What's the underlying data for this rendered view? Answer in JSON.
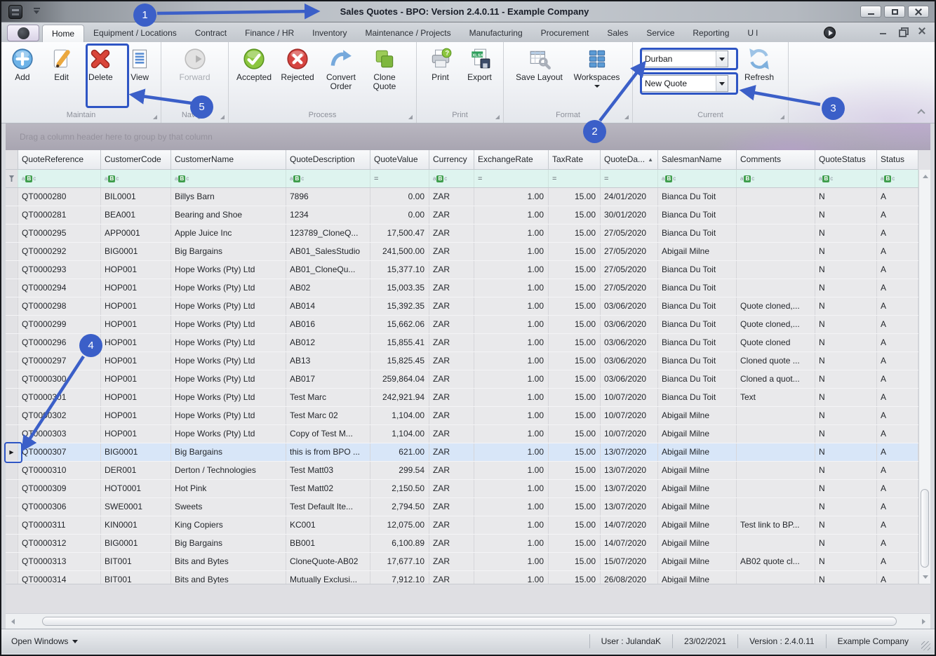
{
  "window": {
    "title": "Sales Quotes - BPO: Version 2.4.0.11 - Example Company"
  },
  "tabs": [
    {
      "label": "Home",
      "selected": true
    },
    {
      "label": "Equipment / Locations"
    },
    {
      "label": "Contract"
    },
    {
      "label": "Finance / HR"
    },
    {
      "label": "Inventory"
    },
    {
      "label": "Maintenance / Projects"
    },
    {
      "label": "Manufacturing"
    },
    {
      "label": "Procurement"
    },
    {
      "label": "Sales"
    },
    {
      "label": "Service"
    },
    {
      "label": "Reporting"
    },
    {
      "label": "U l",
      "obscured": true
    }
  ],
  "ribbon": {
    "groups": [
      {
        "caption": "Maintain",
        "buttons": [
          {
            "label": "Add"
          },
          {
            "label": "Edit"
          },
          {
            "label": "Delete",
            "highlighted": true
          },
          {
            "label": "View"
          }
        ]
      },
      {
        "caption": "Navig...",
        "buttons": [
          {
            "label": "Forward",
            "disabled": true
          }
        ]
      },
      {
        "caption": "Process",
        "buttons": [
          {
            "label": "Accepted"
          },
          {
            "label": "Rejected"
          },
          {
            "label": "Convert\nOrder"
          },
          {
            "label": "Clone\nQuote"
          }
        ]
      },
      {
        "caption": "Print",
        "buttons": [
          {
            "label": "Print"
          },
          {
            "label": "Export"
          }
        ]
      },
      {
        "caption": "Format",
        "buttons": [
          {
            "label": "Save Layout"
          },
          {
            "label": "Workspaces",
            "dropdown": true
          }
        ]
      },
      {
        "caption": "Current",
        "combos": [
          {
            "value": "Durban",
            "highlighted": true
          },
          {
            "value": "New Quote",
            "highlighted": true
          }
        ],
        "buttons": [
          {
            "label": "Refresh"
          }
        ]
      }
    ]
  },
  "icons": {
    "dialog_launcher": "◢",
    "sort_asc": "▲",
    "row_marker": "▶",
    "export_badge": "XLSX",
    "print_badge": "?"
  },
  "grid": {
    "groupby_hint": "Drag a column header here to group by that column",
    "columns": [
      {
        "label": "QuoteReference",
        "filter": "text"
      },
      {
        "label": "CustomerCode",
        "filter": "text"
      },
      {
        "label": "CustomerName",
        "filter": "text"
      },
      {
        "label": "QuoteDescription",
        "filter": "text"
      },
      {
        "label": "QuoteValue",
        "filter": "number"
      },
      {
        "label": "Currency",
        "filter": "text"
      },
      {
        "label": "ExchangeRate",
        "filter": "number"
      },
      {
        "label": "TaxRate",
        "filter": "number"
      },
      {
        "label": "QuoteDa...",
        "filter": "number",
        "sorted": true
      },
      {
        "label": "SalesmanName",
        "filter": "text"
      },
      {
        "label": "Comments",
        "filter": "text"
      },
      {
        "label": "QuoteStatus",
        "filter": "text"
      },
      {
        "label": "Status",
        "filter": "text"
      }
    ],
    "rows": [
      {
        "cells": [
          "QT0000280",
          "BIL0001",
          "Billys Barn",
          "7896",
          "0.00",
          "ZAR",
          "1.00",
          "15.00",
          "24/01/2020",
          "Bianca Du Toit",
          "",
          "N",
          "A"
        ]
      },
      {
        "cells": [
          "QT0000281",
          "BEA001",
          "Bearing and Shoe",
          "1234",
          "0.00",
          "ZAR",
          "1.00",
          "15.00",
          "30/01/2020",
          "Bianca Du Toit",
          "",
          "N",
          "A"
        ]
      },
      {
        "cells": [
          "QT0000295",
          "APP0001",
          "Apple Juice Inc",
          "123789_CloneQ...",
          "17,500.47",
          "ZAR",
          "1.00",
          "15.00",
          "27/05/2020",
          "Bianca Du Toit",
          "",
          "N",
          "A"
        ]
      },
      {
        "cells": [
          "QT0000292",
          "BIG0001",
          "Big Bargains",
          "AB01_SalesStudio",
          "241,500.00",
          "ZAR",
          "1.00",
          "15.00",
          "27/05/2020",
          "Abigail Milne",
          "",
          "N",
          "A"
        ]
      },
      {
        "cells": [
          "QT0000293",
          "HOP001",
          "Hope Works (Pty) Ltd",
          "AB01_CloneQu...",
          "15,377.10",
          "ZAR",
          "1.00",
          "15.00",
          "27/05/2020",
          "Bianca Du Toit",
          "",
          "N",
          "A"
        ]
      },
      {
        "cells": [
          "QT0000294",
          "HOP001",
          "Hope Works (Pty) Ltd",
          "AB02",
          "15,003.35",
          "ZAR",
          "1.00",
          "15.00",
          "27/05/2020",
          "Bianca Du Toit",
          "",
          "N",
          "A"
        ]
      },
      {
        "cells": [
          "QT0000298",
          "HOP001",
          "Hope Works (Pty) Ltd",
          "AB014",
          "15,392.35",
          "ZAR",
          "1.00",
          "15.00",
          "03/06/2020",
          "Bianca Du Toit",
          "Quote cloned,...",
          "N",
          "A"
        ]
      },
      {
        "cells": [
          "QT0000299",
          "HOP001",
          "Hope Works (Pty) Ltd",
          "AB016",
          "15,662.06",
          "ZAR",
          "1.00",
          "15.00",
          "03/06/2020",
          "Bianca Du Toit",
          "Quote cloned,...",
          "N",
          "A"
        ]
      },
      {
        "cells": [
          "QT0000296",
          "HOP001",
          "Hope Works (Pty) Ltd",
          "AB012",
          "15,855.41",
          "ZAR",
          "1.00",
          "15.00",
          "03/06/2020",
          "Bianca Du Toit",
          "Quote cloned",
          "N",
          "A"
        ]
      },
      {
        "cells": [
          "QT0000297",
          "HOP001",
          "Hope Works (Pty) Ltd",
          "AB13",
          "15,825.45",
          "ZAR",
          "1.00",
          "15.00",
          "03/06/2020",
          "Bianca Du Toit",
          "Cloned quote ...",
          "N",
          "A"
        ]
      },
      {
        "cells": [
          "QT0000300",
          "HOP001",
          "Hope Works (Pty) Ltd",
          "AB017",
          "259,864.04",
          "ZAR",
          "1.00",
          "15.00",
          "03/06/2020",
          "Bianca Du Toit",
          "Cloned a quot...",
          "N",
          "A"
        ]
      },
      {
        "cells": [
          "QT0000301",
          "HOP001",
          "Hope Works (Pty) Ltd",
          "Test Marc",
          "242,921.94",
          "ZAR",
          "1.00",
          "15.00",
          "10/07/2020",
          "Bianca Du Toit",
          "Text",
          "N",
          "A"
        ]
      },
      {
        "cells": [
          "QT0000302",
          "HOP001",
          "Hope Works (Pty) Ltd",
          "Test Marc 02",
          "1,104.00",
          "ZAR",
          "1.00",
          "15.00",
          "10/07/2020",
          "Abigail Milne",
          "",
          "N",
          "A"
        ]
      },
      {
        "cells": [
          "QT0000303",
          "HOP001",
          "Hope Works (Pty) Ltd",
          "Copy of Test M...",
          "1,104.00",
          "ZAR",
          "1.00",
          "15.00",
          "10/07/2020",
          "Abigail Milne",
          "",
          "N",
          "A"
        ]
      },
      {
        "cells": [
          "QT0000307",
          "BIG0001",
          "Big Bargains",
          "this is from BPO ...",
          "621.00",
          "ZAR",
          "1.00",
          "15.00",
          "13/07/2020",
          "Abigail Milne",
          "",
          "N",
          "A"
        ],
        "selected": true
      },
      {
        "cells": [
          "QT0000310",
          "DER001",
          "Derton / Technologies",
          "Test Matt03",
          "299.54",
          "ZAR",
          "1.00",
          "15.00",
          "13/07/2020",
          "Abigail Milne",
          "",
          "N",
          "A"
        ]
      },
      {
        "cells": [
          "QT0000309",
          "HOT0001",
          "Hot Pink",
          "Test Matt02",
          "2,150.50",
          "ZAR",
          "1.00",
          "15.00",
          "13/07/2020",
          "Abigail Milne",
          "",
          "N",
          "A"
        ]
      },
      {
        "cells": [
          "QT0000306",
          "SWE0001",
          "Sweets",
          "Test Default Ite...",
          "2,794.50",
          "ZAR",
          "1.00",
          "15.00",
          "13/07/2020",
          "Abigail Milne",
          "",
          "N",
          "A"
        ]
      },
      {
        "cells": [
          "QT0000311",
          "KIN0001",
          "King Copiers",
          "KC001",
          "12,075.00",
          "ZAR",
          "1.00",
          "15.00",
          "14/07/2020",
          "Abigail Milne",
          "Test link to BP...",
          "N",
          "A"
        ]
      },
      {
        "cells": [
          "QT0000312",
          "BIG0001",
          "Big Bargains",
          "BB001",
          "6,100.89",
          "ZAR",
          "1.00",
          "15.00",
          "14/07/2020",
          "Abigail Milne",
          "",
          "N",
          "A"
        ]
      },
      {
        "cells": [
          "QT0000313",
          "BIT001",
          "Bits and Bytes",
          "CloneQuote-AB02",
          "17,677.10",
          "ZAR",
          "1.00",
          "15.00",
          "15/07/2020",
          "Abigail Milne",
          "AB02 quote cl...",
          "N",
          "A"
        ]
      },
      {
        "cells": [
          "QT0000314",
          "BIT001",
          "Bits and Bytes",
          "Mutually Exclusi...",
          "7,912.10",
          "ZAR",
          "1.00",
          "15.00",
          "26/08/2020",
          "Abigail Milne",
          "",
          "N",
          "A"
        ]
      }
    ]
  },
  "statusbar": {
    "open_windows": "Open Windows",
    "user": "User : JulandaK",
    "date": "23/02/2021",
    "version": "Version : 2.4.0.11",
    "company": "Example Company"
  },
  "annotations": [
    {
      "label": "1"
    },
    {
      "label": "2"
    },
    {
      "label": "3"
    },
    {
      "label": "4"
    },
    {
      "label": "5"
    }
  ]
}
